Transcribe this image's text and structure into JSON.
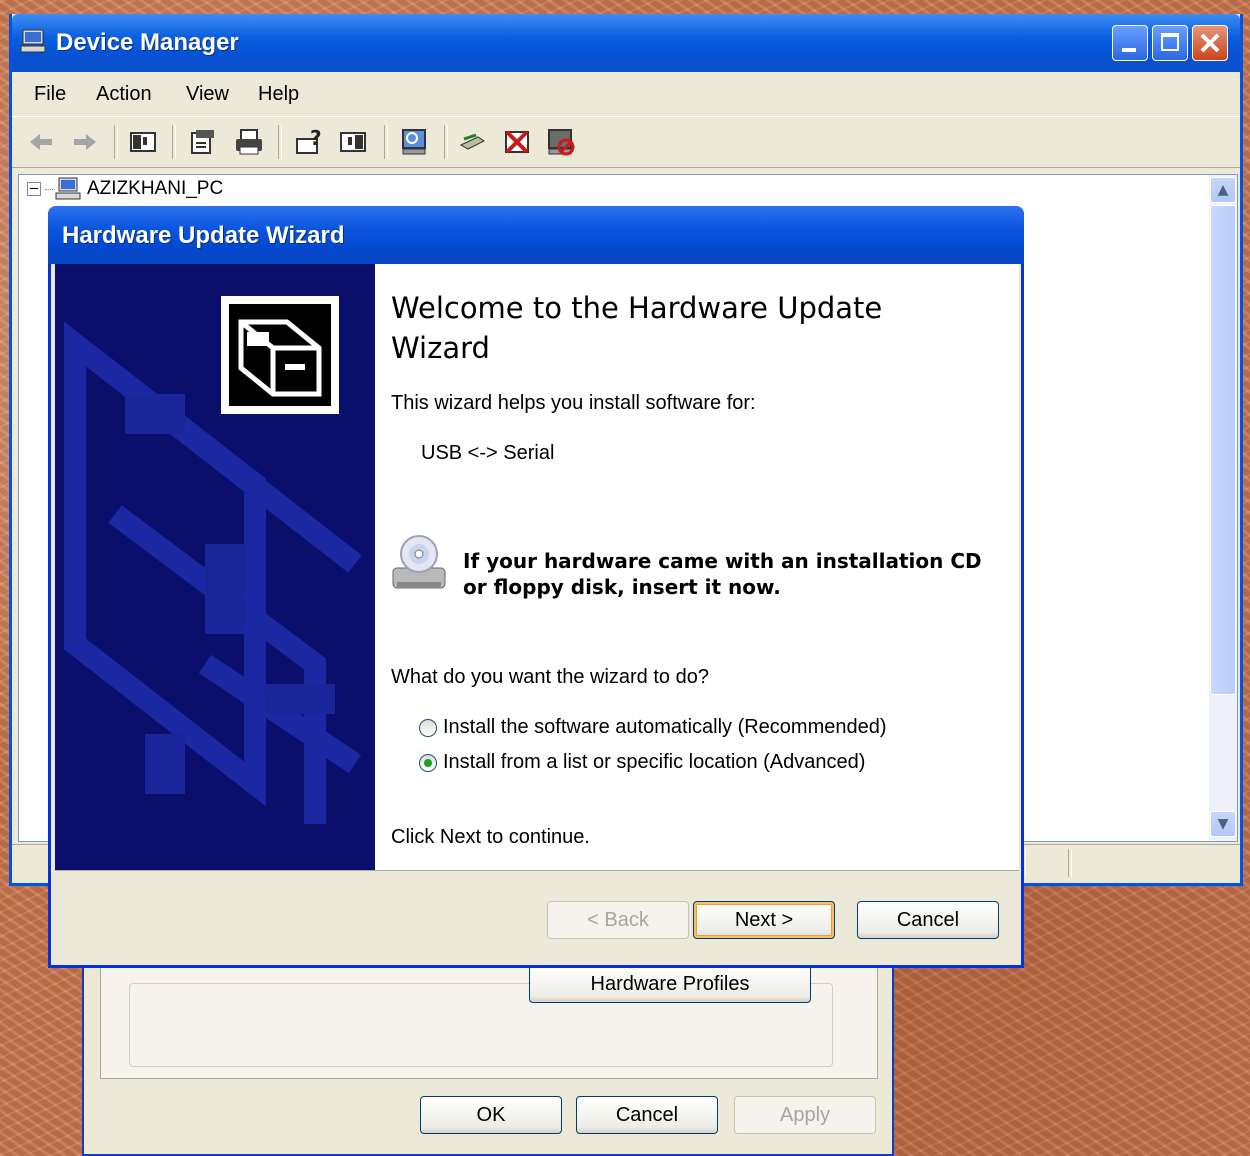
{
  "background_dialog": {
    "hardware_profiles_label": "Hardware Profiles",
    "ok_label": "OK",
    "cancel_label": "Cancel",
    "apply_label": "Apply"
  },
  "device_manager": {
    "title": "Device Manager",
    "menu": [
      "File",
      "Action",
      "View",
      "Help"
    ],
    "toolbar_icons": [
      "back-icon",
      "forward-icon",
      "show-hide-tree-icon",
      "properties-icon",
      "print-icon",
      "help-icon",
      "console-icon",
      "scan-hardware-icon",
      "update-driver-icon",
      "uninstall-icon",
      "disable-icon"
    ],
    "tree_root": "AZIZKHANI_PC"
  },
  "wizard": {
    "title": "Hardware Update Wizard",
    "heading": "Welcome to the Hardware Update Wizard",
    "intro": "This wizard helps you install software for:",
    "device": "USB <-> Serial",
    "cd_notice_line1": "If your hardware came with an installation CD",
    "cd_notice_line2": "or floppy disk, insert it now.",
    "question": "What do you want the wizard to do?",
    "options": [
      {
        "label": "Install the software automatically (Recommended)",
        "selected": false
      },
      {
        "label": "Install from a list or specific location (Advanced)",
        "selected": true
      }
    ],
    "continue_hint": "Click Next to continue.",
    "back_label": "< Back",
    "next_label": "Next >",
    "cancel_label": "Cancel"
  },
  "colors": {
    "titlebar_blue": "#0a55de",
    "wizard_side": "#0a0f6b",
    "dialog_face": "#ece9d8",
    "desktop": "#c9754e"
  }
}
